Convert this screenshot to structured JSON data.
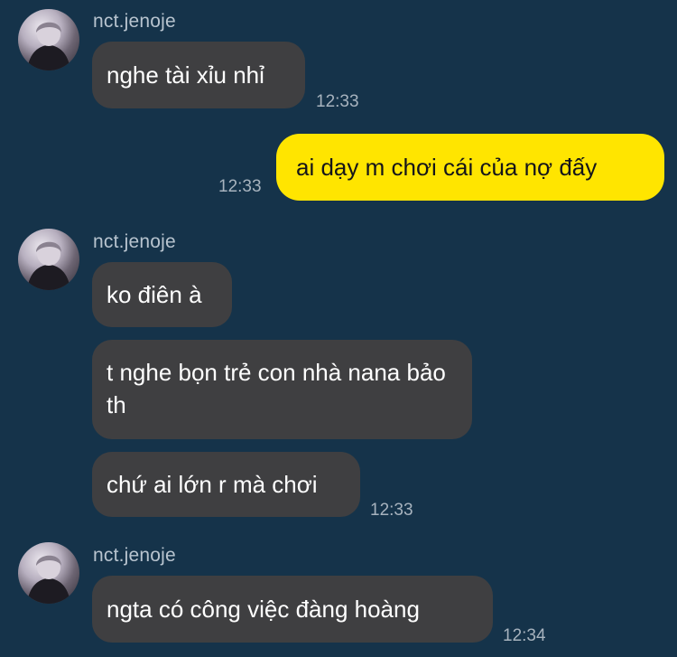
{
  "messages": [
    {
      "sender": "nct.jenoje",
      "text": "nghe tài xỉu nhỉ",
      "time": "12:33"
    },
    {
      "text": "ai dạy m chơi cái của nợ đấy",
      "time": "12:33"
    },
    {
      "sender": "nct.jenoje",
      "text": "ko điên à"
    },
    {
      "text": "t nghe bọn trẻ con nhà nana bảo th"
    },
    {
      "text": "chứ ai lớn r mà chơi",
      "time": "12:33"
    },
    {
      "sender": "nct.jenoje",
      "text": "ngta có công việc đàng hoàng",
      "time": "12:34"
    }
  ],
  "colors": {
    "background": "#15334a",
    "incoming_bubble": "#3f3f41",
    "outgoing_bubble": "#ffe500"
  }
}
